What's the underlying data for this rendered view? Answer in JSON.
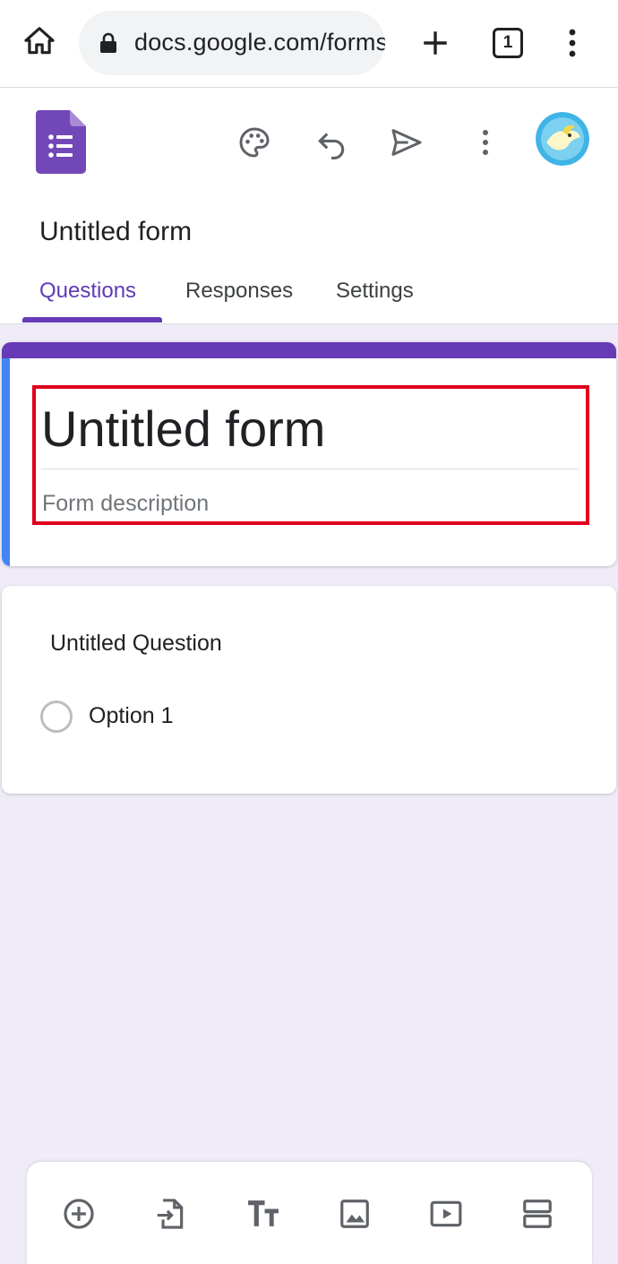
{
  "browser": {
    "url": "docs.google.com/forms",
    "tab_count": "1",
    "icons": [
      "home-icon",
      "lock-icon",
      "plus-icon",
      "tab-switcher-icon",
      "more-vert-icon"
    ]
  },
  "header": {
    "doc_title": "Untitled form",
    "icons": [
      "forms-logo-icon",
      "palette-icon",
      "undo-icon",
      "send-icon",
      "more-vert-icon",
      "avatar"
    ],
    "tabs": [
      {
        "label": "Questions",
        "active": true
      },
      {
        "label": "Responses",
        "active": false
      },
      {
        "label": "Settings",
        "active": false
      }
    ]
  },
  "form": {
    "title": "Untitled form",
    "description_placeholder": "Form description"
  },
  "question": {
    "title": "Untitled Question",
    "options": [
      "Option 1"
    ]
  },
  "toolbar": {
    "icons": [
      "add-question-icon",
      "import-questions-icon",
      "add-title-icon",
      "add-image-icon",
      "add-video-icon",
      "add-section-icon"
    ]
  },
  "colors": {
    "accent": "#673ab7",
    "tab_active": "#5f3bb4",
    "left_stripe": "#4285f4",
    "highlight": "#e0001b",
    "background": "#efebf7"
  }
}
